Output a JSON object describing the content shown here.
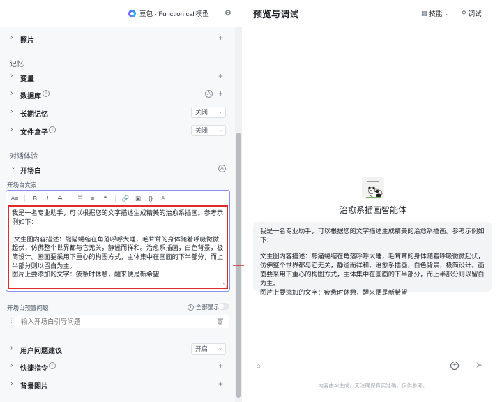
{
  "header": {
    "model_name": "豆包 · Function call模型"
  },
  "top_row": {
    "label": "照片"
  },
  "memory": {
    "section_title": "记忆",
    "items": [
      {
        "label": "变量"
      },
      {
        "label": "数据库"
      },
      {
        "label": "长期记忆",
        "value": "关闭"
      },
      {
        "label": "文件盒子",
        "value": "关闭"
      }
    ]
  },
  "dialog": {
    "section_title": "对话体验",
    "opening": {
      "label": "开场白",
      "editor_label": "开场白文案",
      "toolbar_font": "A≡",
      "text_intro": "我是一名专业助手，可以根据您的文字描述生成精美的治愈系插画。参考示例如下：",
      "text_body": "文生图内容描述：熊猫蜷缩在角落呼呼大睡，毛茸茸的身体随着呼吸微微起伏，仿佛整个世界都与它无关，静谧而祥和。治愈系插画，白色背景，极简设计。画面要采用下重心的构图方式，主体集中在画面的下半部分，而上半部分则以留白为主。",
      "text_caption": "图片上要添加的文字：疲惫时休憩，醒来便是新希望"
    },
    "preset": {
      "label": "开场白预置问题",
      "show_all": "全部显示",
      "placeholder": "输入开场白引导问题"
    },
    "bottom_items": [
      {
        "label": "用户问题建议",
        "value": "开启"
      },
      {
        "label": "快捷指令"
      },
      {
        "label": "背景图片"
      }
    ]
  },
  "preview": {
    "title": "预览与调试",
    "skills_label": "技能",
    "debug_label": "调试",
    "agent_name": "治愈系插画智能体",
    "message_intro": "我是一名专业助手，可以根据您的文字描述生成精美的治愈系插画。参考示例如下：",
    "message_body": "文生图内容描述：熊猫蜷缩在角落呼呼大睡，毛茸茸的身体随着呼吸微微起伏，仿佛整个世界都与它无关，静谧而祥和。治愈系插画，白色背景，极简设计。画面要采用下重心的构图方式，主体集中在画面的下半部分，而上半部分则以留白为主。",
    "message_caption": "图片上要添加的文字：疲惫时休憩，醒来便是新希望",
    "chat_placeholder": "",
    "disclaimer": "内容由AI生成，无法确保真实准确，仅供参考。"
  },
  "colors": {
    "highlight_border": "#e32a2a",
    "arrow": "#e32a2a",
    "editor_focus": "#8a8ff0"
  }
}
